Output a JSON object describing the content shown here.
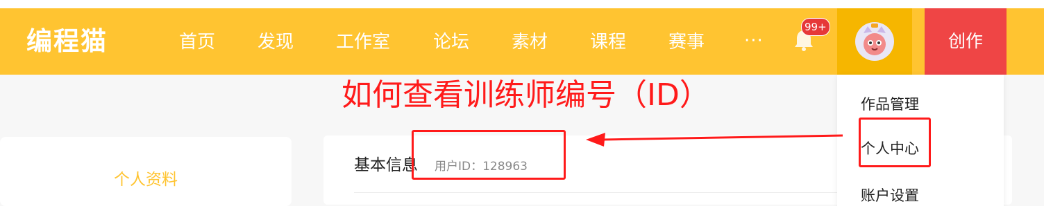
{
  "header": {
    "logo": "编程猫",
    "nav": [
      "首页",
      "发现",
      "工作室",
      "论坛",
      "素材",
      "课程",
      "赛事"
    ],
    "more": "···",
    "notification_badge": "99+",
    "create_label": "创作"
  },
  "annotation": {
    "title": "如何查看训练师编号（ID）"
  },
  "sidebar": {
    "title": "个人资料"
  },
  "main": {
    "section_title": "基本信息",
    "user_id_text": "用户ID：128963"
  },
  "dropdown": {
    "items": [
      "作品管理",
      "个人中心",
      "账户设置"
    ]
  },
  "colors": {
    "navbar": "#ffc431",
    "avatar_bg": "#f6b600",
    "create_button": "#ef4545",
    "annotation": "#ff1a1a"
  },
  "icons": {
    "bell": "bell-icon",
    "avatar": "avatar-icon",
    "arrow": "arrow-left-icon"
  }
}
